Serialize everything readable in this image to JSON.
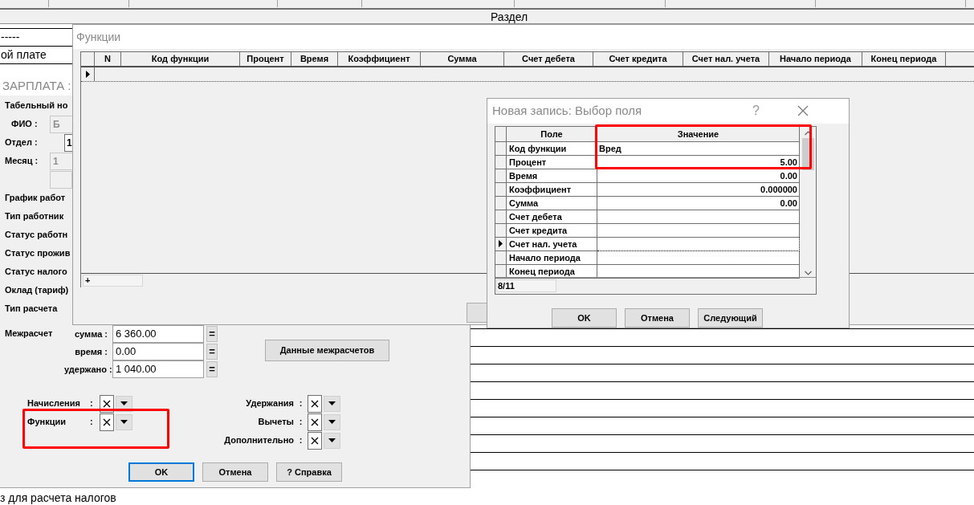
{
  "header": {
    "title": "Раздел"
  },
  "background_rows": [
    "-----",
    "ой плате"
  ],
  "salary_form": {
    "title": "ЗАРПЛАТА :",
    "fields": [
      {
        "label": "Табельный но",
        "kind": "plain"
      },
      {
        "label": "ФИО :",
        "kind": "disabled",
        "value": "Б"
      },
      {
        "label": "Отдел :",
        "kind": "input",
        "value": "1"
      },
      {
        "label": "Месяц :",
        "kind": "disabled",
        "value": "1"
      },
      {
        "kind": "blank"
      },
      {
        "label": "График работ",
        "kind": "plain"
      },
      {
        "label": "Тип работник",
        "kind": "plain"
      },
      {
        "label": "Статус работн",
        "kind": "plain"
      },
      {
        "label": "Статус прожив",
        "kind": "plain"
      },
      {
        "label": "Статус налого",
        "kind": "plain"
      },
      {
        "label": "Оклад (тариф)",
        "kind": "plain"
      },
      {
        "label": "Тип расчета",
        "kind": "plain"
      }
    ],
    "interim": {
      "label": "Межрасчет",
      "rows": [
        {
          "label": "сумма :",
          "value": "6 360.00",
          "button": "="
        },
        {
          "label": "время :",
          "value": "0.00",
          "button": "="
        },
        {
          "label": "удержано :",
          "value": "1 040.00",
          "button": "="
        }
      ],
      "data_button": "Данные межрасчетов"
    },
    "filters_left": [
      {
        "label": "Начисления",
        "colon": ":",
        "checked": true
      },
      {
        "label": "Функции",
        "colon": ":",
        "checked": true
      }
    ],
    "filters_right": [
      {
        "label": "Удержания",
        "colon": ":",
        "checked": true
      },
      {
        "label": "Вычеты",
        "colon": ":",
        "checked": true
      },
      {
        "label": "Дополнительно",
        "colon": ":",
        "checked": true
      }
    ],
    "buttons": [
      {
        "label": "OK",
        "focused": true
      },
      {
        "label": "Отмена",
        "focused": false
      },
      {
        "label": "? Справка",
        "focused": false
      }
    ]
  },
  "functions_window": {
    "title": "Функции",
    "columns": [
      "N",
      "Код функции",
      "Процент",
      "Время",
      "Коэффициент",
      "Сумма",
      "Счет дебета",
      "Счет кредита",
      "Счет нал. учета",
      "Начало периода",
      "Конец периода"
    ],
    "footer_cell": "+"
  },
  "new_record_dialog": {
    "title": "Новая запись: Выбор поля",
    "help_button": "?",
    "columns": [
      "Поле",
      "Значение"
    ],
    "rows": [
      {
        "field": "Код функции",
        "value": "Вред",
        "kind": "text",
        "selected": false
      },
      {
        "field": "Процент",
        "value": "5.00",
        "kind": "number",
        "selected": false
      },
      {
        "field": "Время",
        "value": "0.00",
        "kind": "number",
        "selected": false
      },
      {
        "field": "Коэффициент",
        "value": "0.000000",
        "kind": "number",
        "selected": false
      },
      {
        "field": "Сумма",
        "value": "0.00",
        "kind": "number",
        "selected": false
      },
      {
        "field": "Счет дебета",
        "value": "",
        "kind": "text",
        "selected": false
      },
      {
        "field": "Счет кредита",
        "value": "",
        "kind": "text",
        "selected": false
      },
      {
        "field": "Счет нал. учета",
        "value": "",
        "kind": "text",
        "selected": true
      },
      {
        "field": "Начало периода",
        "value": "",
        "kind": "text",
        "selected": false
      },
      {
        "field": "Конец периода",
        "value": "",
        "kind": "text",
        "selected": false
      }
    ],
    "position": "8/11",
    "buttons": [
      "OK",
      "Отмена",
      "Следующий"
    ]
  },
  "footer_text": "з для расчета налогов"
}
